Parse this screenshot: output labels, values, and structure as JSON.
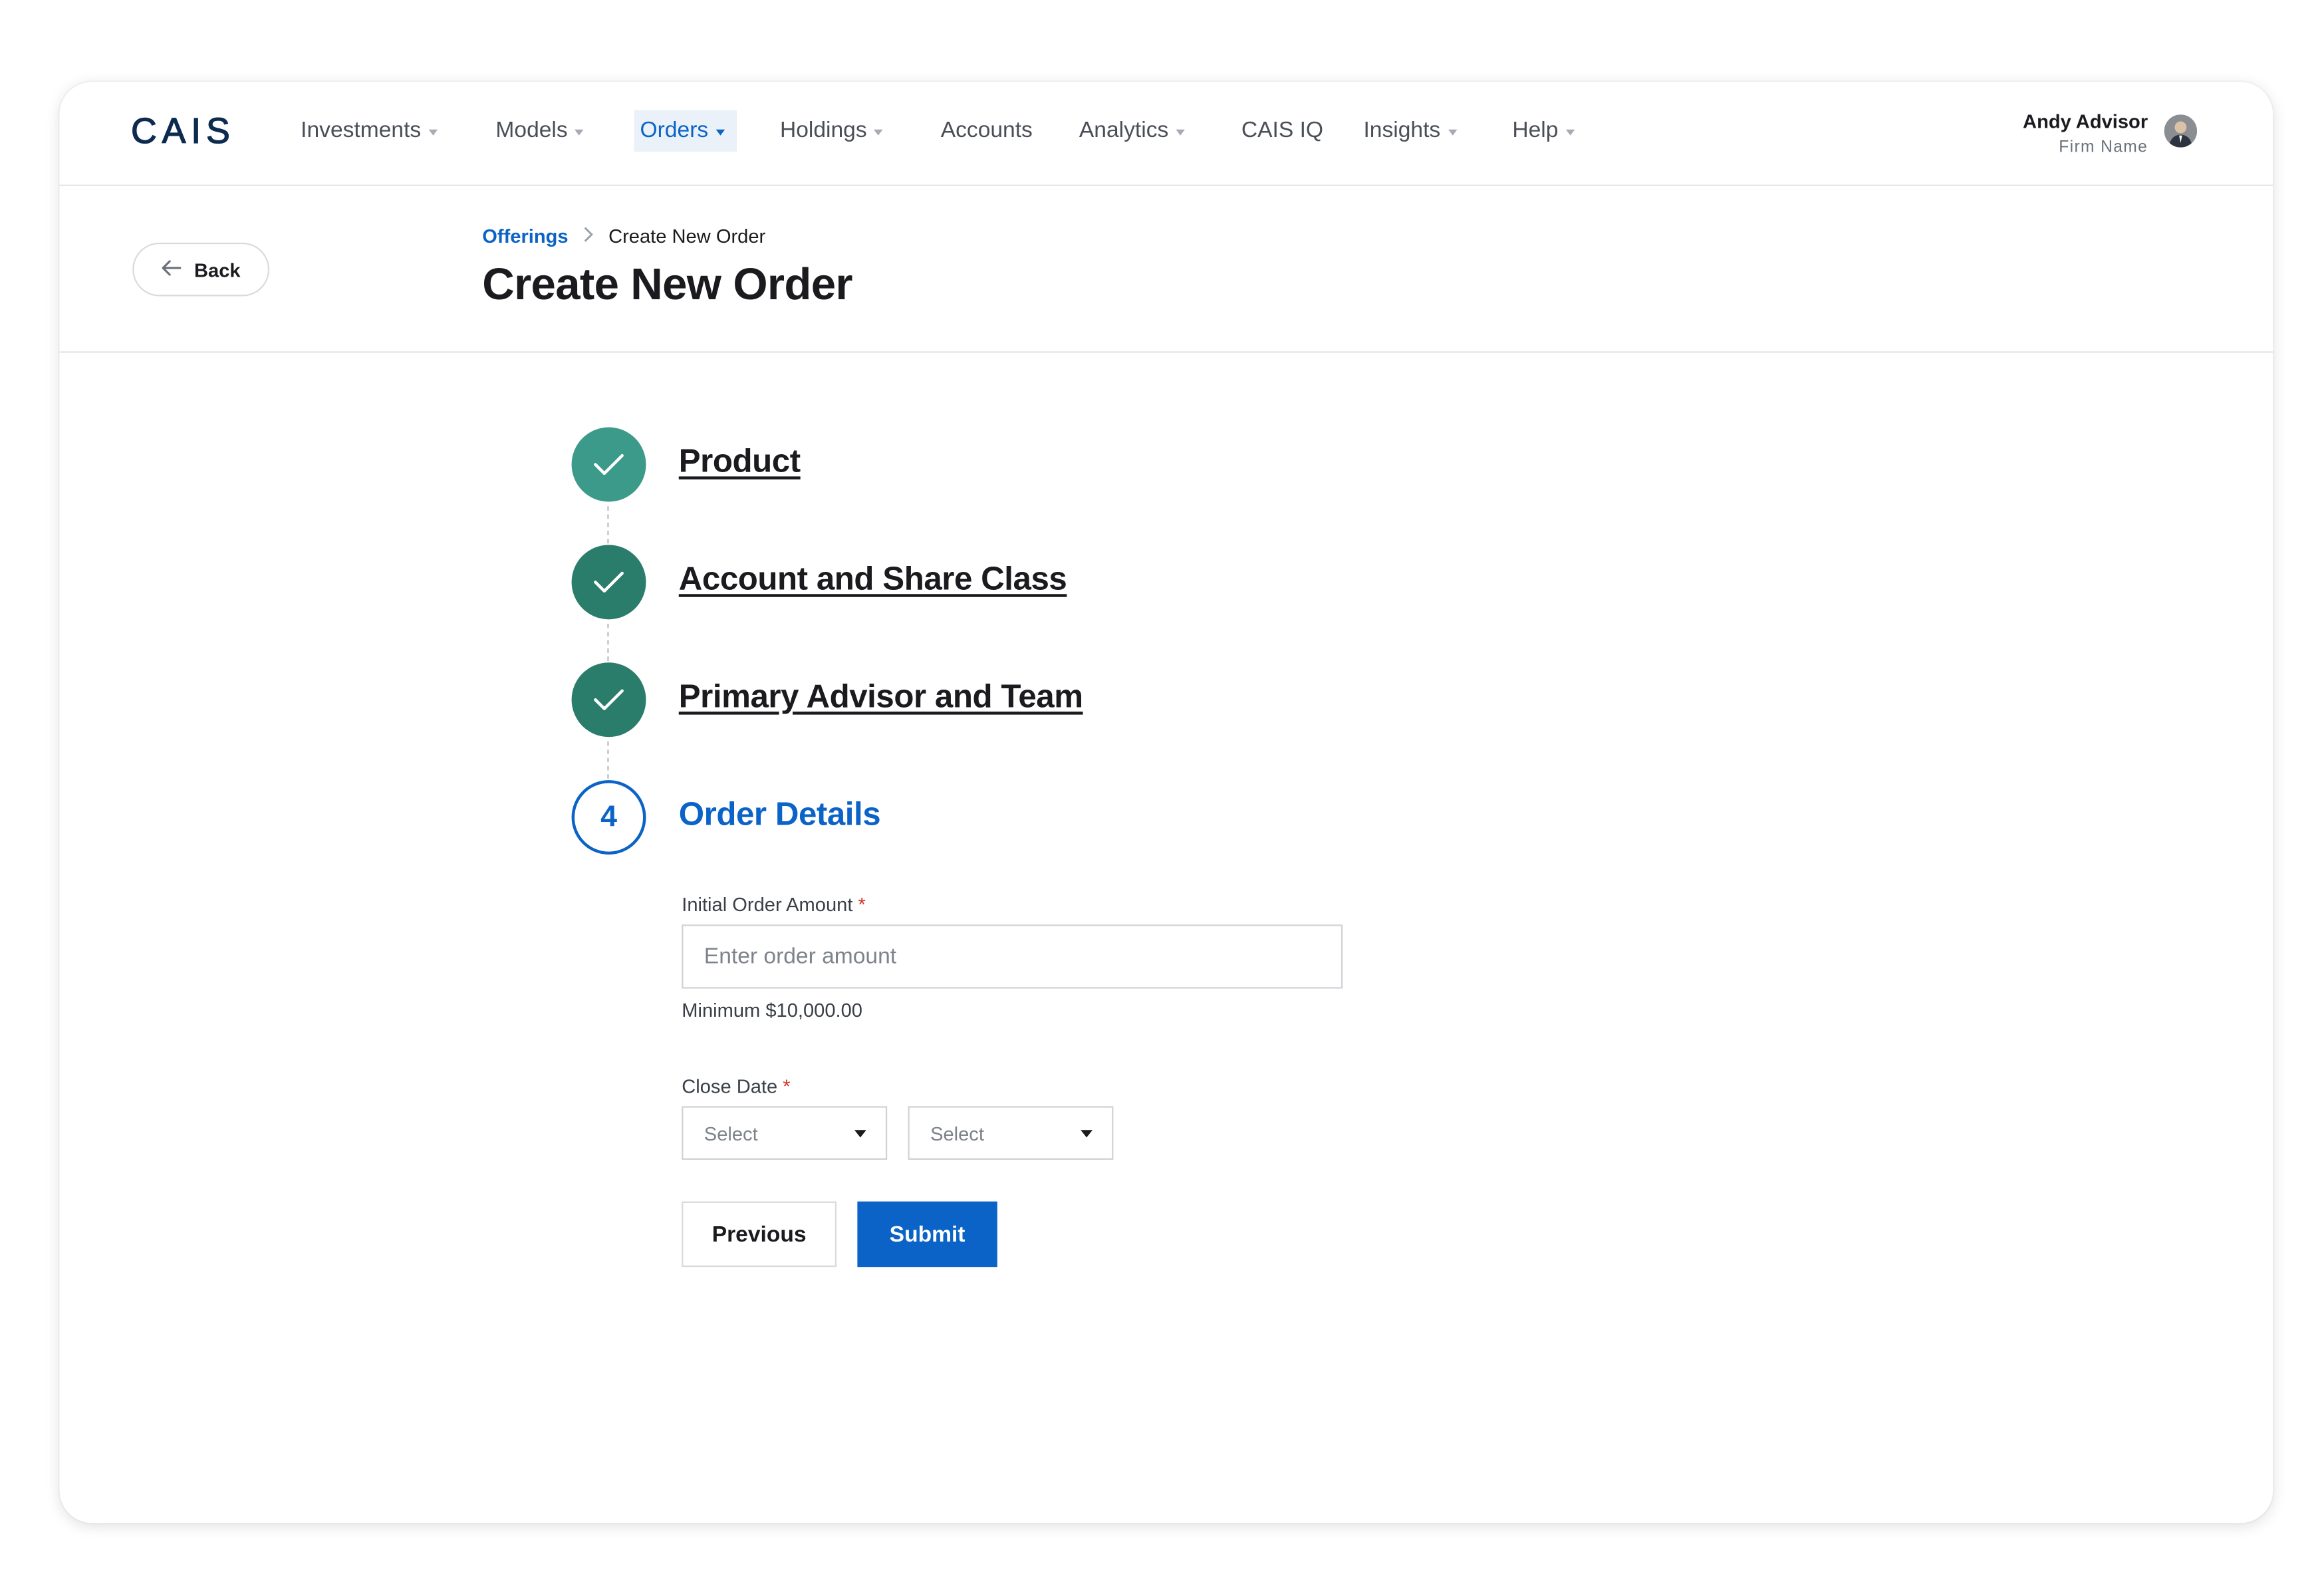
{
  "brand": {
    "logo_text": "CAIS",
    "primary_color": "#0b63c7",
    "success_color": "#2b7d6b"
  },
  "nav": {
    "items": [
      {
        "label": "Investments",
        "has_dropdown": true
      },
      {
        "label": "Models",
        "has_dropdown": true
      },
      {
        "label": "Orders",
        "has_dropdown": true,
        "active": true
      },
      {
        "label": "Holdings",
        "has_dropdown": true
      },
      {
        "label": "Accounts",
        "has_dropdown": false
      },
      {
        "label": "Analytics",
        "has_dropdown": true
      },
      {
        "label": "CAIS IQ",
        "has_dropdown": false
      },
      {
        "label": "Insights",
        "has_dropdown": true
      },
      {
        "label": "Help",
        "has_dropdown": true
      }
    ]
  },
  "user": {
    "name": "Andy Advisor",
    "firm": "Firm Name",
    "avatar_icon": "user-avatar"
  },
  "header": {
    "back_label": "Back",
    "breadcrumb": {
      "link": "Offerings",
      "current": "Create New Order"
    },
    "title": "Create New Order"
  },
  "steps": [
    {
      "label": "Product",
      "status": "complete",
      "icon": "check-icon"
    },
    {
      "label": "Account and Share Class",
      "status": "complete",
      "icon": "check-icon"
    },
    {
      "label": "Primary Advisor and Team",
      "status": "complete",
      "icon": "check-icon"
    },
    {
      "number": "4",
      "label": "Order Details",
      "status": "current"
    }
  ],
  "form": {
    "amount": {
      "label": "Initial Order Amount",
      "required_mark": "*",
      "placeholder": "Enter order amount",
      "value": "",
      "helper": "Minimum $10,000.00"
    },
    "close_date": {
      "label": "Close Date",
      "required_mark": "*",
      "select1": "Select",
      "select2": "Select"
    },
    "previous_label": "Previous",
    "submit_label": "Submit"
  }
}
